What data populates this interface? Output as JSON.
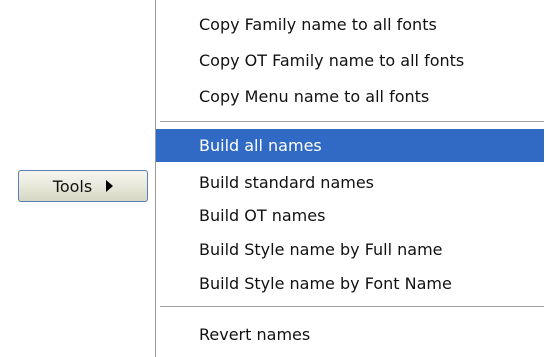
{
  "tools_button": {
    "label": "Tools",
    "arrow_icon": "triangle-right-icon"
  },
  "menu": {
    "group1": [
      "Copy Family name to all fonts",
      "Copy OT Family name to all fonts",
      "Copy Menu name to all fonts"
    ],
    "group2": [
      "Build all names",
      "Build standard names",
      "Build OT names",
      "Build Style name by Full name",
      "Build Style name by Font Name"
    ],
    "group3": [
      "Revert names"
    ],
    "highlighted_item": "Build all names"
  },
  "colors": {
    "highlight_bg": "#316ac5",
    "highlight_text": "#ffffff",
    "button_border": "#5a7fb3"
  }
}
